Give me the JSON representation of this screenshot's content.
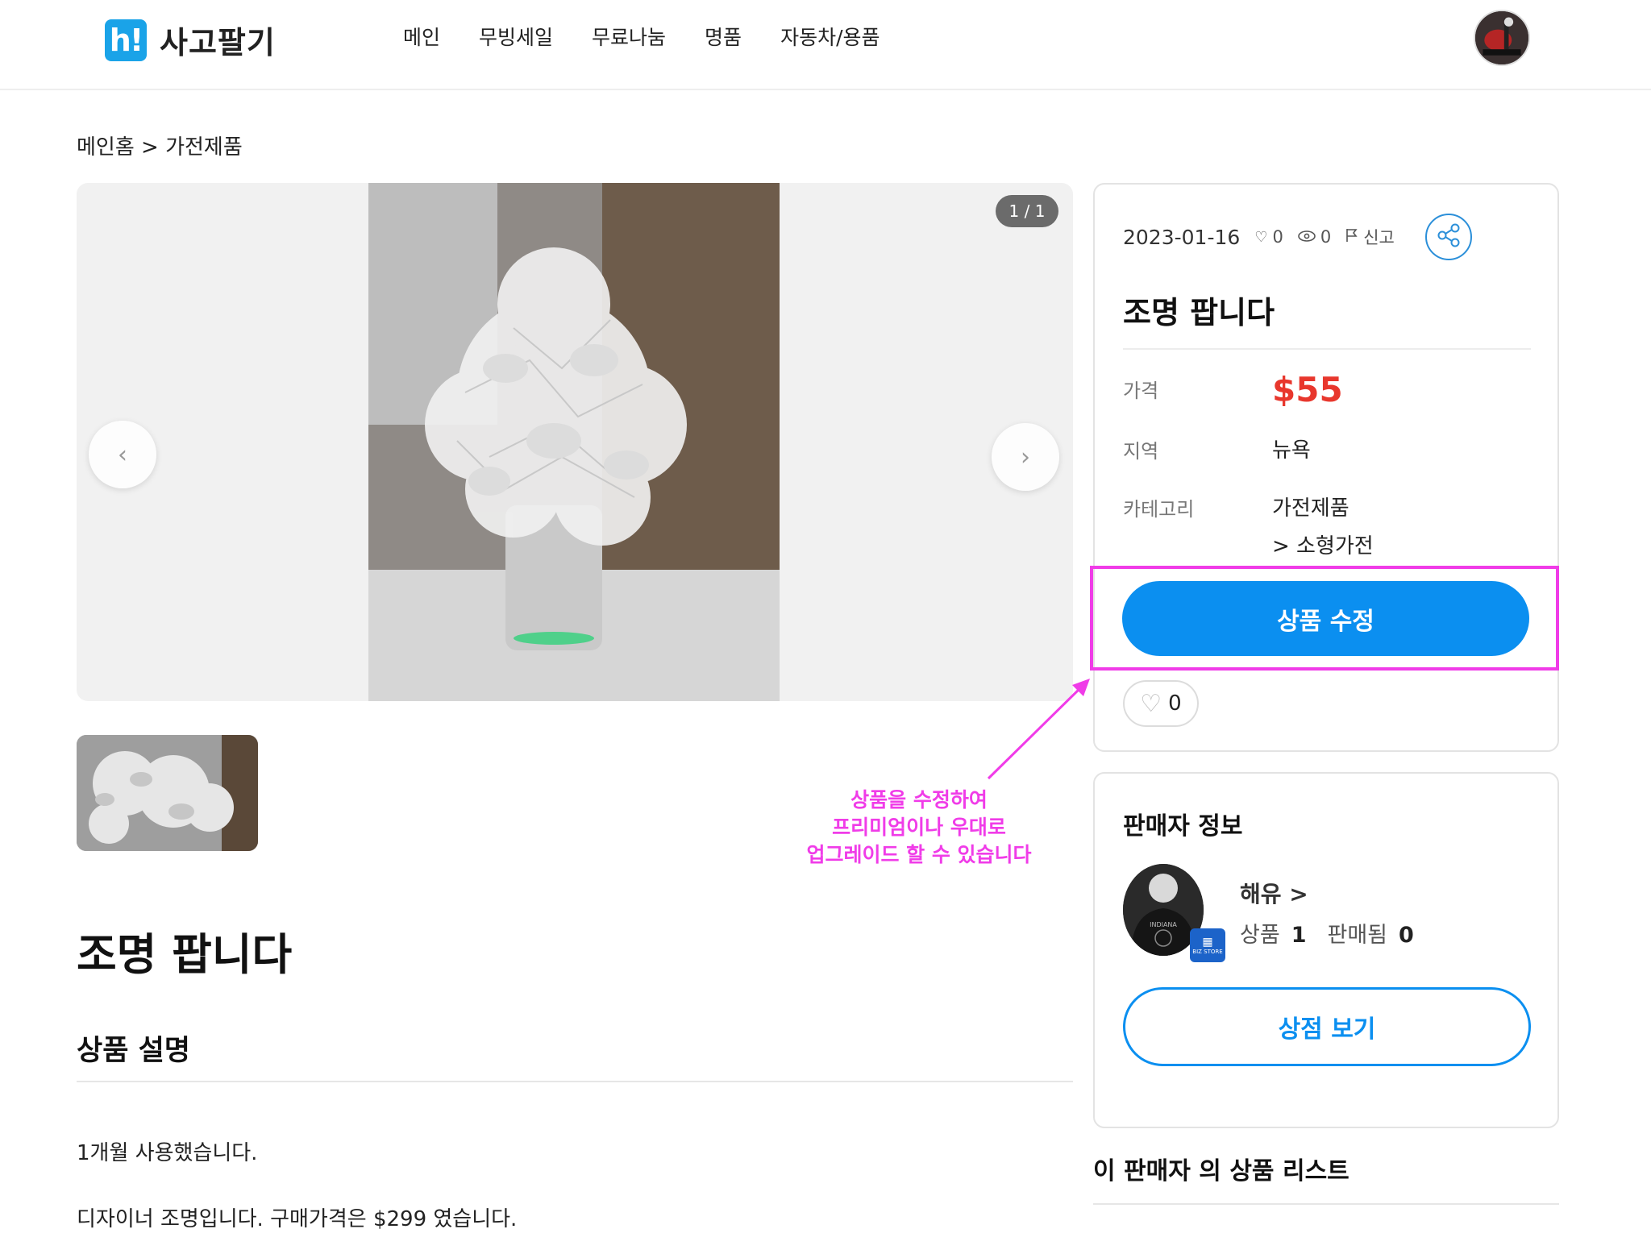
{
  "header": {
    "logo_badge": "h!",
    "logo_text": "사고팔기",
    "nav": [
      "메인",
      "무빙세일",
      "무료나눔",
      "명품",
      "자동차/용품"
    ]
  },
  "breadcrumb": "메인홈 > 가전제품",
  "gallery": {
    "counter": "1 / 1",
    "prev_icon": "‹",
    "next_icon": "›"
  },
  "product": {
    "title": "조명 팝니다",
    "description_heading": "상품 설명",
    "description_lines": [
      "1개월 사용했습니다.",
      "디자이너 조명입니다. 구매가격은 $299 였습니다."
    ]
  },
  "info_card": {
    "date": "2023-01-16",
    "likes": "0",
    "views": "0",
    "report_label": "신고",
    "title": "조명 팝니다",
    "price_label": "가격",
    "price": "$55",
    "location_label": "지역",
    "location": "뉴욕",
    "category_label": "카테고리",
    "category": "가전제품",
    "subcategory": "> 소형가전",
    "edit_button": "상품 수정",
    "like_count": "0"
  },
  "annotation": {
    "lines": [
      "상품을 수정하여",
      "프리미엄이나 우대로",
      "업그레이드 할 수 있습니다"
    ],
    "color": "#f03ce8"
  },
  "seller": {
    "heading": "판매자 정보",
    "name": "해유 >",
    "products_label": "상품",
    "products_count": "1",
    "sold_label": "판매됨",
    "sold_count": "0",
    "badge_text": "BIZ STORE",
    "store_button": "상점 보기"
  },
  "seller_list_heading": "이 판매자 의 상품 리스트",
  "colors": {
    "brand": "#1aa3e8",
    "primary_button": "#0b8ff0",
    "price": "#e8372d",
    "highlight": "#f03ce8"
  }
}
